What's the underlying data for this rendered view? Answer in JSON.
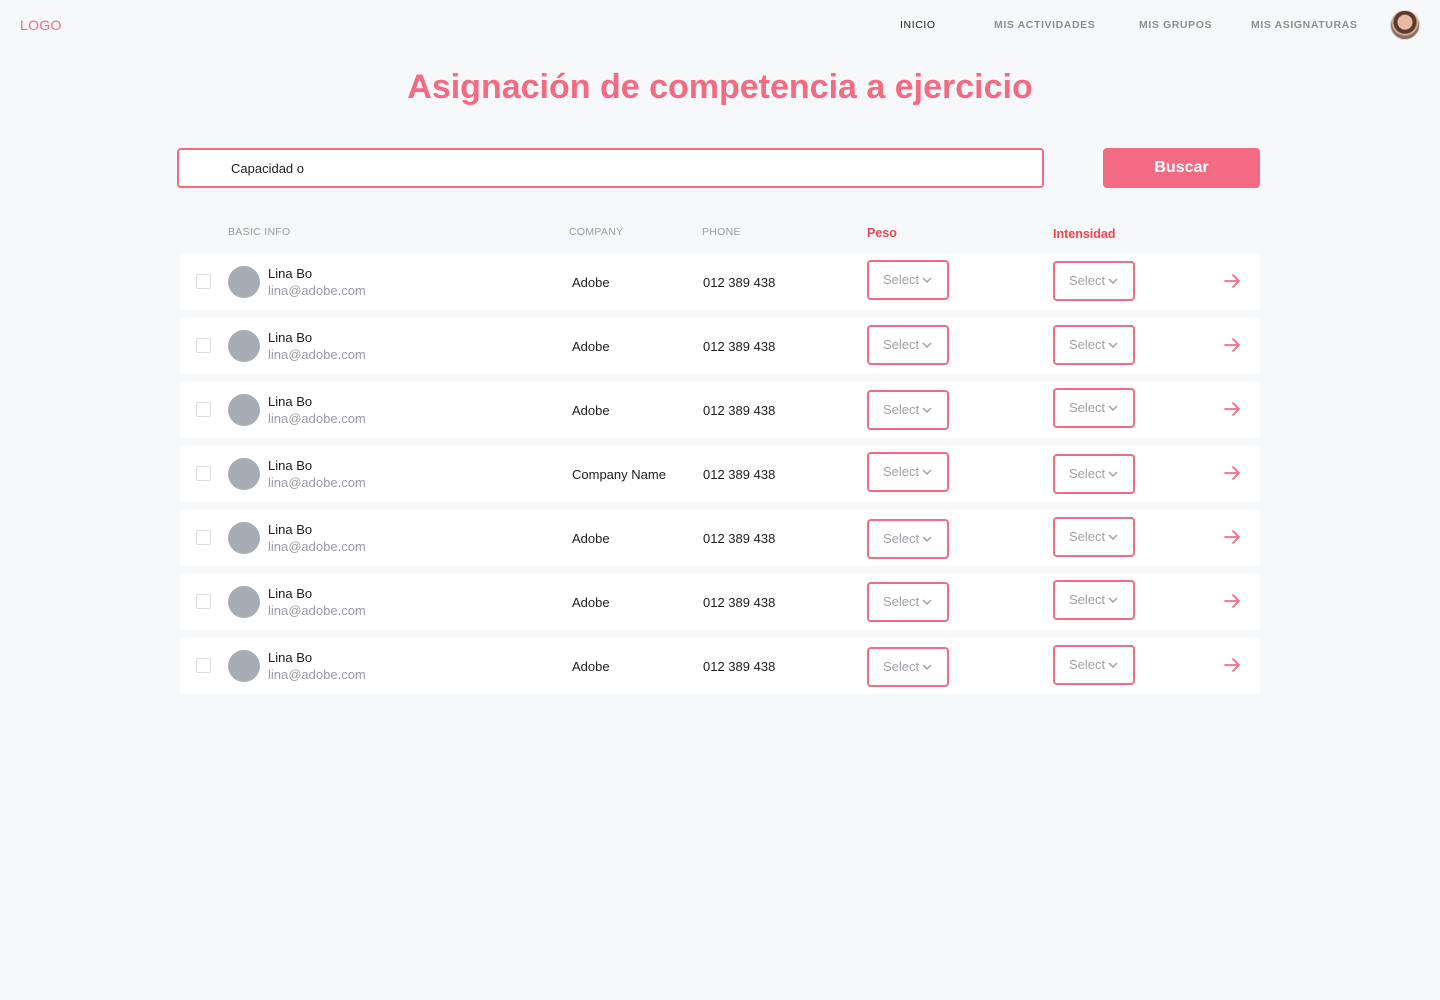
{
  "header": {
    "logo": "LOGO",
    "nav": [
      {
        "label": "INICIO",
        "active": true
      },
      {
        "label": "MIS ACTIVIDADES",
        "active": false
      },
      {
        "label": "MIS GRUPOS",
        "active": false
      },
      {
        "label": "MIS ASIGNATURAS",
        "active": false
      }
    ]
  },
  "title": "Asignación de competencia a ejercicio",
  "search": {
    "value": "Capacidad o",
    "button_label": "Buscar"
  },
  "table": {
    "columns": {
      "basic_info": "BASIC INFO",
      "company": "COMPANY",
      "phone": "PHONE",
      "peso": "Peso",
      "intensidad": "Intensidad"
    },
    "select_placeholder": "Select",
    "rows": [
      {
        "name": "Lina Bo",
        "email": "lina@adobe.com",
        "company": "Adobe",
        "phone": "012 389 438"
      },
      {
        "name": "Lina Bo",
        "email": "lina@adobe.com",
        "company": "Adobe",
        "phone": "012 389 438"
      },
      {
        "name": "Lina Bo",
        "email": "lina@adobe.com",
        "company": "Adobe",
        "phone": "012 389 438"
      },
      {
        "name": "Lina Bo",
        "email": "lina@adobe.com",
        "company": "Company Name",
        "phone": "012 389 438"
      },
      {
        "name": "Lina Bo",
        "email": "lina@adobe.com",
        "company": "Adobe",
        "phone": "012 389 438"
      },
      {
        "name": "Lina Bo",
        "email": "lina@adobe.com",
        "company": "Adobe",
        "phone": "012 389 438"
      },
      {
        "name": "Lina Bo",
        "email": "lina@adobe.com",
        "company": "Adobe",
        "phone": "012 389 438"
      }
    ]
  },
  "colors": {
    "accent": "#f26b83",
    "header_accent": "#f0454e",
    "background": "#f7f8fa",
    "muted_text": "#9a9ba5",
    "avatar_placeholder": "#a6abb4"
  },
  "icons": {
    "row_action": "arrow-right-icon",
    "select_caret": "chevron-down-icon",
    "user": "avatar"
  }
}
